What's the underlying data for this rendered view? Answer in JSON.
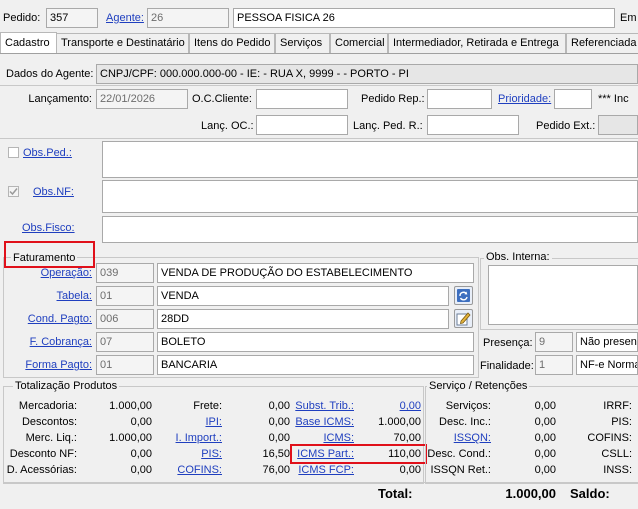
{
  "header": {
    "pedido_label": "Pedido:",
    "pedido_value": "357",
    "agente_label": "Agente:",
    "agente_code": "26",
    "agente_name": "PESSOA FISICA 26",
    "cut_label": "Em"
  },
  "tabs": [
    "Cadastro",
    "Transporte e Destinatário",
    "Itens do Pedido",
    "Serviços",
    "Comercial",
    "Intermediador, Retirada e Entrega",
    "Referenciada"
  ],
  "agent": {
    "label": "Dados do Agente:",
    "info": "CNPJ/CPF: 000.000.000-00 - IE:  - RUA X, 9999 -  - PORTO - PI"
  },
  "fields": {
    "lancamento_label": "Lançamento:",
    "lancamento_value": "22/01/2026",
    "oc_cliente_label": "O.C.Cliente:",
    "pedido_rep_label": "Pedido Rep.:",
    "prioridade_label": "Prioridade:",
    "prioridade_text": "*** Inc",
    "lanc_oc_label": "Lanç. OC.:",
    "lanc_ped_r_label": "Lanç. Ped. R.:",
    "pedido_ext_label": "Pedido Ext.:"
  },
  "obs": {
    "ped_label": "Obs.Ped.:",
    "nf_label": "Obs.NF:",
    "fisco_label": "Obs.Fisco:",
    "interna_label": "Obs. Interna:"
  },
  "faturamento": {
    "title": "Faturamento",
    "operacao_label": "Operação:",
    "operacao_code": "039",
    "operacao_desc": "VENDA DE PRODUÇÃO DO ESTABELECIMENTO",
    "tabela_label": "Tabela:",
    "tabela_code": "01",
    "tabela_desc": "VENDA",
    "cond_label": "Cond. Pagto:",
    "cond_code": "006",
    "cond_desc": "28DD",
    "cobranca_label": "F. Cobrança:",
    "cobranca_code": "07",
    "cobranca_desc": "BOLETO",
    "forma_label": "Forma Pagto:",
    "forma_code": "01",
    "forma_desc": "BANCARIA",
    "presenca_label": "Presença:",
    "presenca_code": "9",
    "presenca_desc": "Não presen",
    "finalidade_label": "Finalidade:",
    "finalidade_code": "1",
    "finalidade_desc": "NF-e Norma"
  },
  "totals": {
    "produtos_title": "Totalização Produtos",
    "servico_title": "Serviço / Retenções",
    "mercadoria_label": "Mercadoria:",
    "mercadoria": "1.000,00",
    "descontos_label": "Descontos:",
    "descontos": "0,00",
    "merc_liq_label": "Merc. Liq.:",
    "merc_liq": "1.000,00",
    "desconto_nf_label": "Desconto NF:",
    "desconto_nf": "0,00",
    "d_acessorias_label": "D. Acessórias:",
    "d_acessorias": "0,00",
    "frete_label": "Frete:",
    "frete": "0,00",
    "ipi_label": "IPI:",
    "ipi": "0,00",
    "i_import_label": "I. Import.:",
    "i_import": "0,00",
    "pis_label": "PIS:",
    "pis": "16,50",
    "cofins_label": "COFINS:",
    "cofins": "76,00",
    "subst_trib_label": "Subst. Trib.:",
    "subst_trib": "0,00",
    "base_icms_label": "Base ICMS:",
    "base_icms": "1.000,00",
    "icms_label": "ICMS:",
    "icms": "70,00",
    "icms_part_label": "ICMS Part.:",
    "icms_part": "110,00",
    "icms_fcp_label": "ICMS FCP:",
    "icms_fcp": "0,00",
    "servicos_label": "Serviços:",
    "servicos": "0,00",
    "desc_inc_label": "Desc. Inc.:",
    "desc_inc": "0,00",
    "issqn_label": "ISSQN:",
    "issqn": "0,00",
    "desc_cond_label": "Desc. Cond.:",
    "desc_cond": "0,00",
    "issqn_ret_label": "ISSQN Ret.:",
    "issqn_ret": "0,00",
    "irrf_label": "IRRF:",
    "pis_r_label": "PIS:",
    "cofins_r_label": "COFINS:",
    "csll_label": "CSLL:",
    "inss_label": "INSS:",
    "total_label": "Total:",
    "total": "1.000,00",
    "saldo_label": "Saldo:"
  },
  "colors": {
    "link": "#1f3fbf",
    "highlight": "#e0101a"
  }
}
